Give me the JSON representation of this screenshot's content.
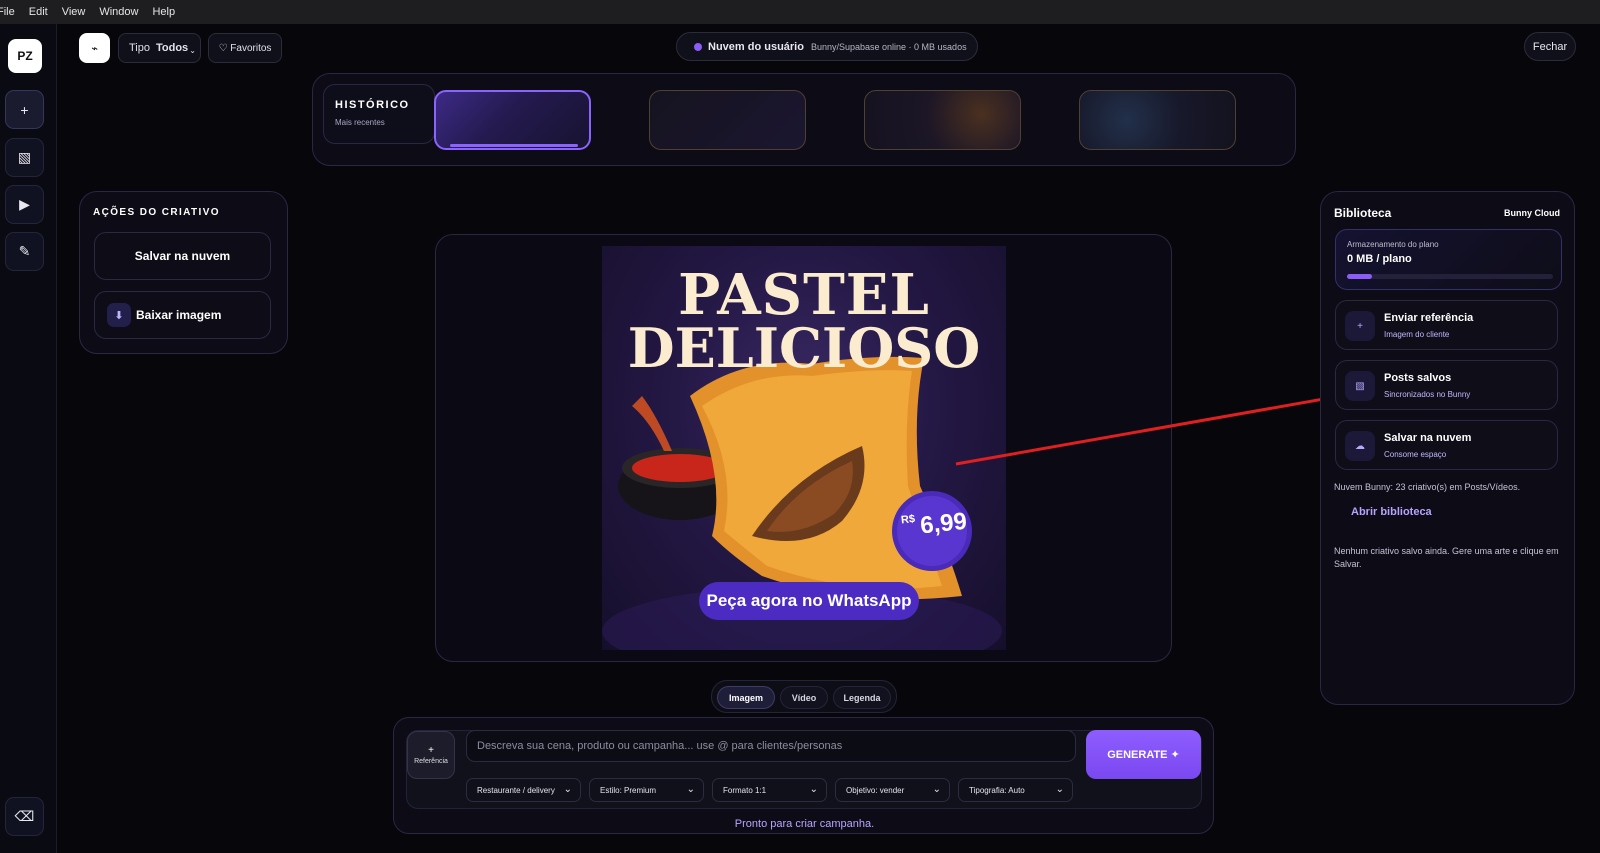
{
  "menu": [
    "File",
    "Edit",
    "View",
    "Window",
    "Help"
  ],
  "logo": "PZ",
  "sidebar": {
    "add": "+",
    "gallery": "▧",
    "play": "▶",
    "edit": "✎",
    "erase": "⌫"
  },
  "topbar": {
    "back_glyph": "⌁",
    "tipo_label": "Tipo",
    "tipo_value": "Todos",
    "favoritos": "♡ Favoritos",
    "cloud_title": "Nuvem do usuário",
    "cloud_status": "Bunny/Supabase online · 0 MB usados",
    "close": "Fechar"
  },
  "history": {
    "title": "HISTÓRICO",
    "subtitle": "Mais recentes"
  },
  "actions": {
    "title": "AÇÕES DO CRIATIVO",
    "save_cloud": "Salvar na nuvem",
    "download": "Baixar imagem",
    "download_icon": "⬇"
  },
  "creative": {
    "headline_1": "PASTEL",
    "headline_2": "DELICIOSO",
    "price_prefix": "R$",
    "price": "6,99",
    "cta": "Peça agora no WhatsApp"
  },
  "library": {
    "title": "Biblioteca",
    "provider": "Bunny Cloud",
    "storage_label": "Armazenamento do plano",
    "storage_value": "0 MB / plano",
    "storage_fraction": 0.12,
    "cards": [
      {
        "icon": "+",
        "title": "Enviar referência",
        "subtitle": "Imagem do cliente"
      },
      {
        "icon": "▧",
        "title": "Posts salvos",
        "subtitle": "Sincronizados no Bunny"
      },
      {
        "icon": "☁",
        "title": "Salvar na nuvem",
        "subtitle": "Consome espaço"
      }
    ],
    "count_note": "Nuvem Bunny: 23 criativo(s) em Posts/Vídeos.",
    "open_link": "Abrir biblioteca",
    "empty_note": "Nenhum criativo salvo ainda. Gere uma arte e clique em Salvar."
  },
  "tabs": [
    "Imagem",
    "Vídeo",
    "Legenda"
  ],
  "composer": {
    "ref_plus": "+",
    "ref_label": "Referência",
    "placeholder": "Descreva sua cena, produto ou campanha... use @ para clientes/personas",
    "generate": "GENERATE ✦",
    "selects": [
      "Restaurante / delivery",
      "Estilo: Premium",
      "Formato 1:1",
      "Objetivo: vender",
      "Tipografia: Auto"
    ],
    "status": "Pronto para criar campanha."
  },
  "colors": {
    "accent": "#7c4dff",
    "bg": "#07070b",
    "annotation_arrow": "#e02020"
  }
}
